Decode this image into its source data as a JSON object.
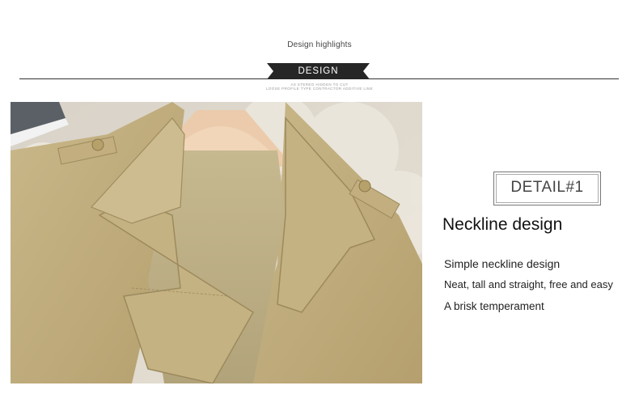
{
  "header": {
    "subtitle": "Design highlights",
    "badge_label": "DESIGN",
    "tagline_line1": "AS STEREO HIDDEN TO CUT",
    "tagline_line2": "LOOSE PROFILE TYPE CONTRACTOR ADDITIVE LINE"
  },
  "detail": {
    "badge": "DETAIL#1",
    "heading": "Neckline design",
    "lines": [
      "Simple neckline design",
      "Neat, tall and straight, free and easy",
      "A brisk temperament"
    ]
  },
  "photo": {
    "subject": "khaki trench coat collar on hanger",
    "colors": {
      "coat": "#c2b083",
      "lining": "#b8ab80",
      "hanger": "#e8c6a6",
      "background": "#d9d2c6"
    }
  }
}
